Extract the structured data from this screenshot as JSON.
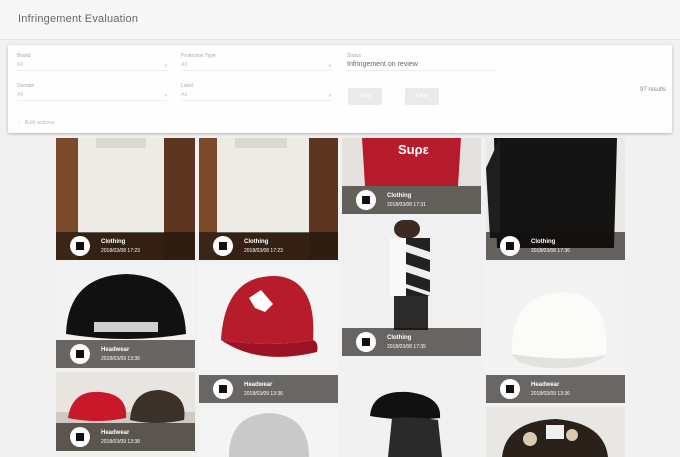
{
  "header": {
    "title": "Infringement Evaluation"
  },
  "filters": {
    "brand": {
      "label": "Brand",
      "placeholder": "All"
    },
    "protection_type": {
      "label": "Protection Type",
      "placeholder": "All"
    },
    "status": {
      "label": "Status",
      "value": "Infringement on review"
    },
    "domain": {
      "label": "Domain",
      "placeholder": "All"
    },
    "field_five": {
      "label": "Label",
      "placeholder": "All"
    },
    "apply_label": "Apply",
    "clear_label": "Clear",
    "results_text": "97 results",
    "bulk_actions_label": "Bulk actions"
  },
  "cards": [
    {
      "category": "Clothing",
      "date": "2018/03/08 17:23"
    },
    {
      "category": "Clothing",
      "date": "2018/03/08 17:23"
    },
    {
      "category": "Clothing",
      "date": "2018/03/08 17:31"
    },
    {
      "category": "Clothing",
      "date": "2018/03/08 17:36"
    },
    {
      "category": "Headwear",
      "date": "2018/03/09 13:36"
    },
    {
      "category": "Headwear",
      "date": "2018/03/09 13:36"
    },
    {
      "category": "Clothing",
      "date": "2018/03/08 17:35"
    },
    {
      "category": "Headwear",
      "date": "2018/03/09 13:36"
    },
    {
      "category": "Headwear",
      "date": "2018/03/09 13:38"
    }
  ],
  "colors": {
    "overlay": "#1a140e",
    "accent": "#b71c2c"
  }
}
